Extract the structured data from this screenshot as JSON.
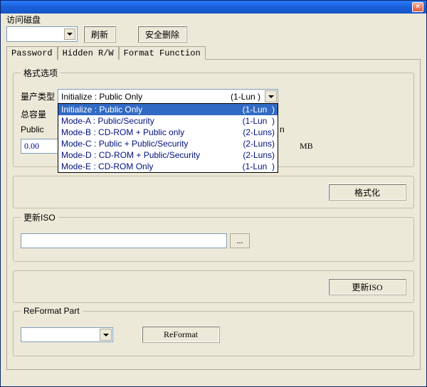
{
  "top": {
    "access_label": "访问磁盘",
    "refresh": "刷新",
    "safe_remove": "安全删除"
  },
  "tabs": {
    "password": "Password",
    "hidden": "Hidden R/W",
    "format": "Format Function"
  },
  "format_group": {
    "legend": "格式选项",
    "type_label": "量产类型",
    "capacity_label": "总容量",
    "public_label": "Public",
    "public_value": "0.00",
    "unit": "MB",
    "hidden_right": "n",
    "combo_display_left": "Initialize : Public Only",
    "combo_display_right": "(1-Lun  )",
    "options": [
      {
        "left": "Initialize : Public Only",
        "right": "(1-Lun  )",
        "selected": true
      },
      {
        "left": "Mode-A : Public/Security",
        "right": "(1-Lun  )",
        "selected": false
      },
      {
        "left": "Mode-B : CD-ROM + Public only",
        "right": "(2-Luns)",
        "selected": false
      },
      {
        "left": "Mode-C : Public + Public/Security",
        "right": "(2-Luns)",
        "selected": false
      },
      {
        "left": "Mode-D : CD-ROM + Public/Security",
        "right": "(2-Luns)",
        "selected": false
      },
      {
        "left": "Mode-E : CD-ROM Only",
        "right": "(1-Lun  )",
        "selected": false
      }
    ]
  },
  "format_btn": "格式化",
  "iso_group": {
    "legend": "更新ISO",
    "browse": "..."
  },
  "update_iso_btn": "更新ISO",
  "reformat_group": {
    "legend": "ReFormat Part",
    "btn": "ReFormat"
  }
}
